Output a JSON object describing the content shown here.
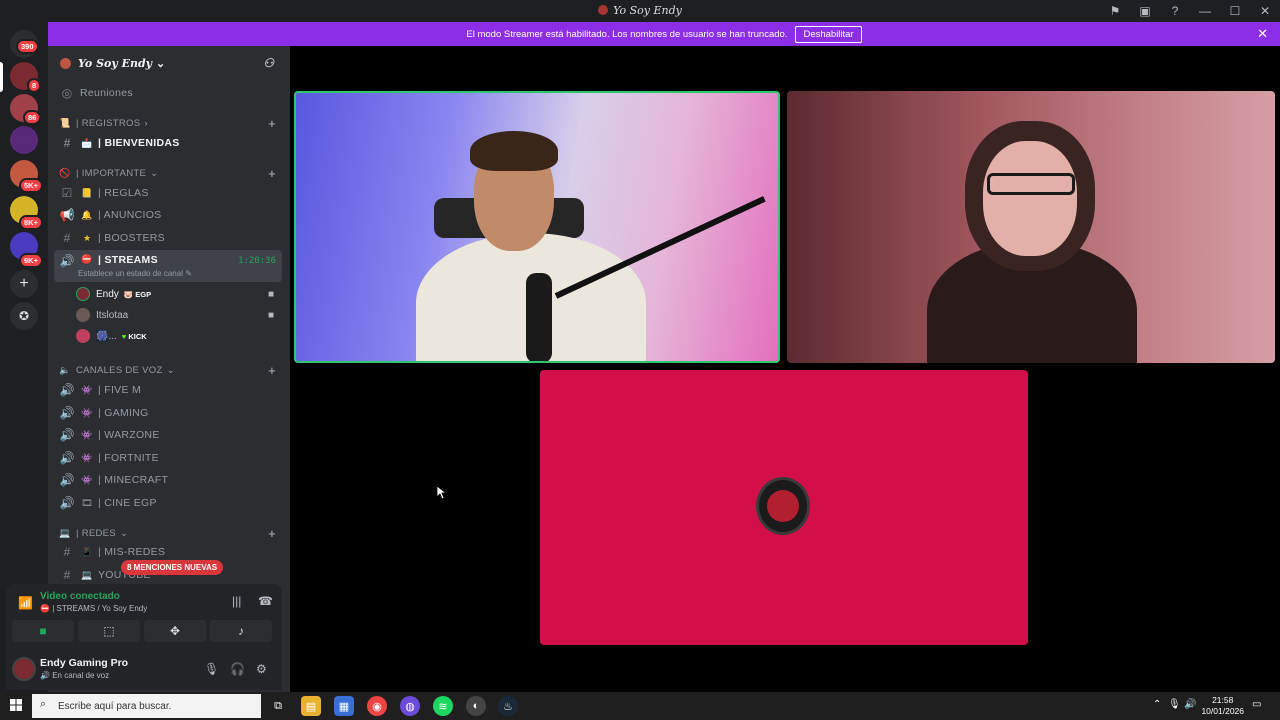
{
  "titlebar": {
    "title": "Yo Soy Endy"
  },
  "streamer_bar": {
    "message": "El modo Streamer está habilitado. Los nombres de usuario se han truncado.",
    "button": "Deshabilitar"
  },
  "guilds": {
    "home_badge": "390",
    "badges": [
      "8",
      "86",
      "5K+",
      "8K+",
      "9K+"
    ]
  },
  "server": {
    "name": "Yo Soy Endy"
  },
  "sidebar": {
    "reuniones": "Reuniones",
    "cat_registros": "| REGISTROS",
    "bienvenidas": "| BIENVENIDAS",
    "cat_importante": "| IMPORTANTE",
    "reglas": "| REGLAS",
    "anuncios": "| ANUNCIOS",
    "boosters": "| BOOSTERS",
    "streams": "| STREAMS",
    "streams_timer": "1:20:36",
    "streams_status": "Establece un estado de canal",
    "users": [
      {
        "name": "Endy",
        "tag": "EGP"
      },
      {
        "name": "Itslotaa",
        "tag": ""
      },
      {
        "name": "🎆...",
        "tag": "KICK"
      }
    ],
    "cat_voz": "CANALES DE VOZ",
    "voice_channels": [
      "| FIVE M",
      "| GAMING",
      "| WARZONE",
      "| FORTNITE",
      "| MINECRAFT",
      "| CINE EGP"
    ],
    "cat_redes": "| REDES",
    "mis_redes": "| MIS-REDES",
    "youtube": "YOUTUBE",
    "mentions": "8 MENCIONES NUEVAS"
  },
  "voice_panel": {
    "title": "Video conectado",
    "channel": "| STREAMS / Yo Soy Endy"
  },
  "user_panel": {
    "name": "Endy Gaming Pro",
    "status": "En canal de voz"
  },
  "taskbar": {
    "search_placeholder": "Escribe aquí para buscar.",
    "time": "21:58",
    "date": "10/01/2026"
  },
  "colors": {
    "accent_purple": "#8c2ee8",
    "speaking_green": "#2dc770",
    "tile_red": "#d20f48"
  }
}
